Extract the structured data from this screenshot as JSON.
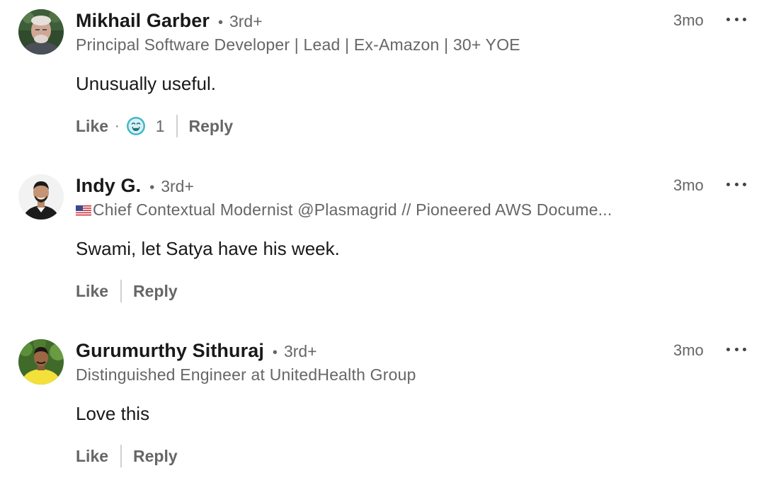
{
  "comments": [
    {
      "name": "Mikhail Garber",
      "degree": "3rd+",
      "headline": "Principal Software Developer | Lead | Ex-Amazon | 30+ YOE",
      "time": "3mo",
      "text": "Unusually useful.",
      "like_label": "Like",
      "reaction_icon": "funny-face-icon",
      "reaction_count": "1",
      "reply_label": "Reply"
    },
    {
      "name": "Indy G.",
      "degree": "3rd+",
      "headline": "Chief Contextual Modernist @Plasmagrid // Pioneered AWS Docume...",
      "headline_flag": "us-flag-icon",
      "time": "3mo",
      "text": "Swami, let Satya have his week.",
      "like_label": "Like",
      "reply_label": "Reply"
    },
    {
      "name": "Gurumurthy Sithuraj",
      "degree": "3rd+",
      "headline": "Distinguished Engineer at UnitedHealth Group",
      "time": "3mo",
      "text": "Love this",
      "like_label": "Like",
      "reply_label": "Reply"
    }
  ],
  "separator_dot": "•",
  "action_dot": "·",
  "colors": {
    "name": "#191919",
    "secondary_text": "#666666",
    "divider": "#d0d0d0",
    "reaction_teal": "#44b7c9"
  }
}
